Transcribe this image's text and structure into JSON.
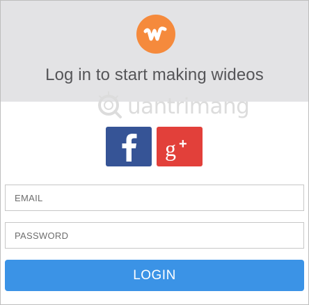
{
  "logo": {
    "glyph": "w",
    "icon": "wideo-logo-icon",
    "color": "#f58a3c"
  },
  "title": "Log in to start making wideos",
  "watermark": {
    "text": "uantrimang",
    "icon": "quantrimang-watermark-icon"
  },
  "social": {
    "facebook": {
      "glyph": "f",
      "icon": "facebook-icon",
      "color": "#365496"
    },
    "google_plus": {
      "glyph": "g+",
      "icon": "google-plus-icon",
      "color": "#e2403a"
    }
  },
  "form": {
    "email": {
      "placeholder": "EMAIL",
      "value": ""
    },
    "password": {
      "placeholder": "PASSWORD",
      "value": ""
    },
    "login_label": "LOGIN",
    "login_color": "#3b93e6"
  }
}
